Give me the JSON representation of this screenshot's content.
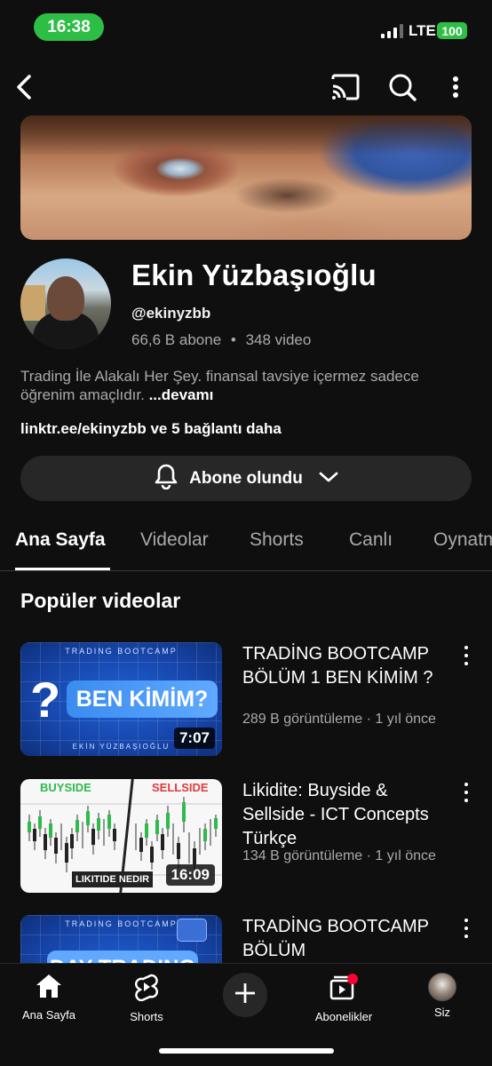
{
  "status_bar": {
    "time": "16:38",
    "network": "LTE",
    "battery": "100"
  },
  "channel": {
    "name": "Ekin Yüzbaşıoğlu",
    "handle": "@ekinyzbb",
    "subscribers": "66,6 B abone",
    "separator": "•",
    "video_count": "348 video",
    "description": "Trading İle Alakalı Her Şey. finansal tavsiye içermez sadece öğrenim amaçlıdır.",
    "description_more": "...devamı",
    "links": "linktr.ee/ekinyzbb ve 5 bağlantı daha",
    "subscribe_label": "Abone olundu"
  },
  "tabs": [
    {
      "label": "Ana Sayfa",
      "active": true
    },
    {
      "label": "Videolar",
      "active": false
    },
    {
      "label": "Shorts",
      "active": false
    },
    {
      "label": "Canlı",
      "active": false
    },
    {
      "label": "Oynatma listeleri",
      "active": false
    }
  ],
  "section": {
    "title": "Popüler videolar"
  },
  "videos": [
    {
      "title": "TRADİNG BOOTCAMP BÖLÜM 1 BEN KİMİM ?",
      "meta": "289 B görüntüleme · 1 yıl önce",
      "duration": "7:07",
      "thumb_top": "TRADING BOOTCAMP",
      "thumb_mark": "?",
      "thumb_text": "BEN KİMİM?",
      "thumb_bottom": "EKİN YÜZBAŞIOĞLU"
    },
    {
      "title": "Likidite: Buyside & Sellside - ICT Concepts Türkçe",
      "meta": "134 B görüntüleme · 1 yıl önce",
      "duration": "16:09",
      "thumb_left": "BUYSIDE",
      "thumb_right": "SELLSIDE",
      "thumb_label": "LIKITIDE NEDIR"
    },
    {
      "title": "TRADİNG BOOTCAMP BÖLÜM",
      "thumb_top": "TRADING BOOTCAMP",
      "thumb_text": "DAY TRADING"
    }
  ],
  "bottom_nav": {
    "home": "Ana Sayfa",
    "shorts": "Shorts",
    "subscriptions": "Abonelikler",
    "you": "Siz"
  },
  "icons": {
    "back": "back-arrow-icon",
    "cast": "cast-icon",
    "search": "search-icon",
    "more": "more-vertical-icon",
    "bell": "bell-icon",
    "chevron": "chevron-down-icon"
  },
  "colors": {
    "background": "#0f0f0f",
    "surface": "#272727",
    "secondary_text": "#aaaaaa",
    "status_green": "#2fbe45",
    "notification_red": "#ff0033"
  }
}
